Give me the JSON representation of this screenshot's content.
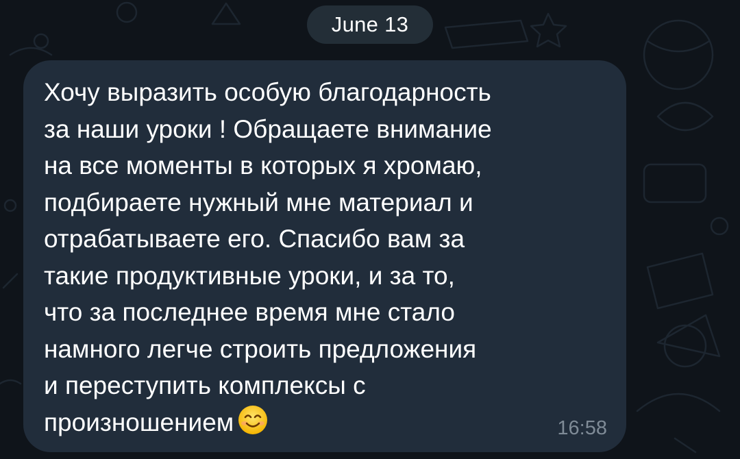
{
  "chat": {
    "date_label": "June 13",
    "message": {
      "text": "Хочу выразить особую благодарность\nза наши уроки ! Обращаете внимание\nна все моменты в которых я хромаю,\nподбираете нужный мне материал и\nотрабатываете его. Спасибо вам за\nтакие продуктивные уроки, и за то,\nчто за последнее время мне стало\nнамного легче строить предложения\nи переступить комплексы с\nпроизношением",
      "emoji": "smiling-face-with-smiling-eyes",
      "time": "16:58"
    }
  },
  "colors": {
    "background": "#0f141a",
    "bubble": "#212d3b",
    "date_pill": "#232e37",
    "text": "#ffffff",
    "time": "#7f8b97"
  }
}
